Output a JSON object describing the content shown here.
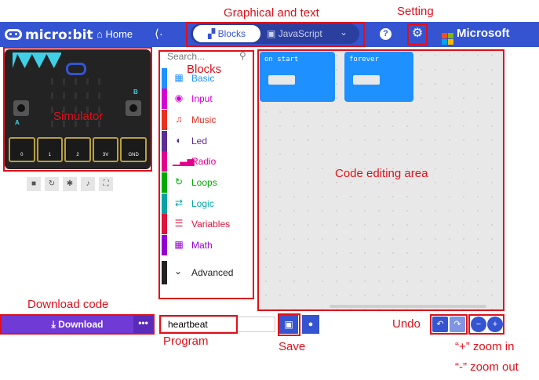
{
  "header": {
    "brand": "micro:bit",
    "home_label": "Home",
    "share_icon": "share-icon",
    "tabs": {
      "blocks": "Blocks",
      "javascript": "JavaScript"
    },
    "help_icon": "question-icon",
    "settings_icon": "gear-icon",
    "microsoft_label": "Microsoft"
  },
  "annotations": {
    "graphical_text": "Graphical and text",
    "setting": "Setting",
    "blocks": "Blocks",
    "simulator": "Simulator",
    "code_editing_area": "Code editing area",
    "download_code": "Download code",
    "program": "Program",
    "save": "Save",
    "undo": "Undo",
    "zoom_in": "“+”   zoom in",
    "zoom_out": "“-”   zoom out"
  },
  "toolbox": {
    "search_placeholder": "Search...",
    "categories": [
      {
        "label": "Basic",
        "color": "#1e90ff"
      },
      {
        "label": "Input",
        "color": "#d400d4"
      },
      {
        "label": "Music",
        "color": "#e63022"
      },
      {
        "label": "Led",
        "color": "#5c2d91"
      },
      {
        "label": "Radio",
        "color": "#e3008c"
      },
      {
        "label": "Loops",
        "color": "#00aa00"
      },
      {
        "label": "Logic",
        "color": "#00a4a6"
      },
      {
        "label": "Variables",
        "color": "#dc143c"
      },
      {
        "label": "Math",
        "color": "#9400d3"
      }
    ],
    "advanced": "Advanced"
  },
  "simulator": {
    "pins": [
      "0",
      "1",
      "2",
      "3V",
      "GND"
    ],
    "button_a": "A",
    "button_b": "B"
  },
  "workspace": {
    "on_start": "on start",
    "forever": "forever"
  },
  "bottom": {
    "download_label": "Download",
    "download_more": "•••",
    "project_name": "heartbeat"
  },
  "colors": {
    "accent": "#3454d1",
    "download": "#6f3ad5",
    "annotation": "#e0101a"
  }
}
